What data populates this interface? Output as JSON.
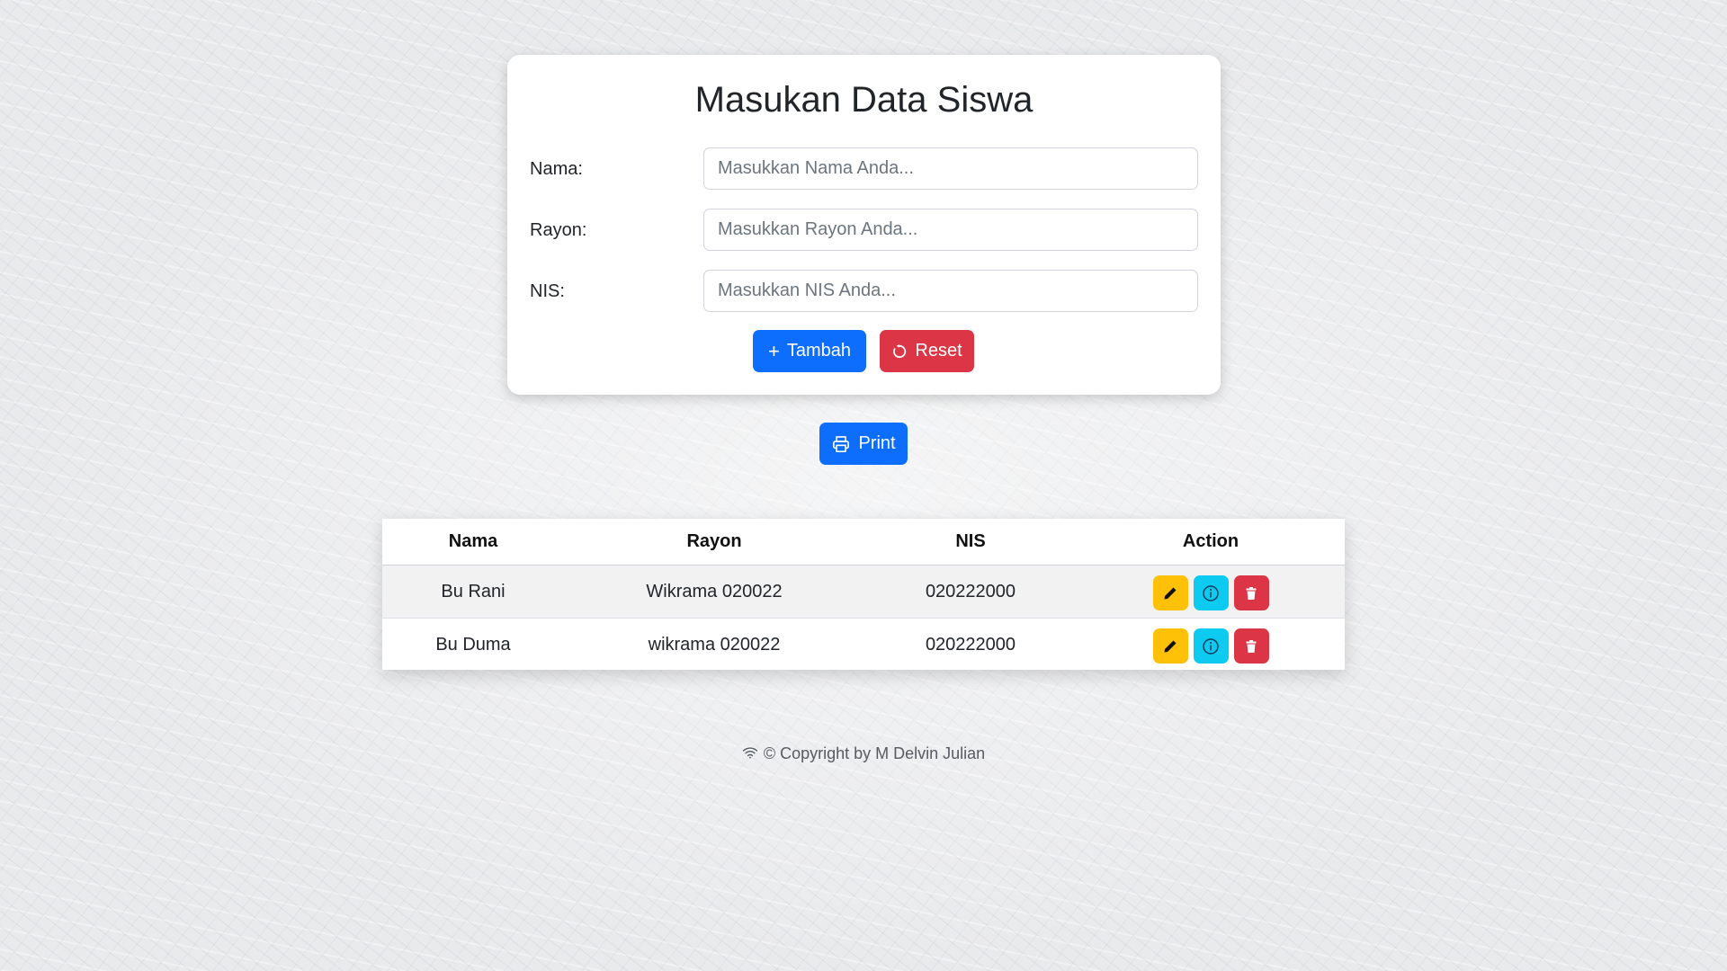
{
  "form": {
    "title": "Masukan Data Siswa",
    "fields": [
      {
        "label": "Nama:",
        "placeholder": "Masukkan Nama Anda...",
        "value": ""
      },
      {
        "label": "Rayon:",
        "placeholder": "Masukkan Rayon Anda...",
        "value": ""
      },
      {
        "label": "NIS:",
        "placeholder": "Masukkan NIS Anda...",
        "value": ""
      }
    ],
    "add_label": "Tambah",
    "reset_label": "Reset"
  },
  "print_label": "Print",
  "table": {
    "headers": [
      "Nama",
      "Rayon",
      "NIS",
      "Action"
    ],
    "rows": [
      {
        "nama": "Bu Rani",
        "rayon": "Wikrama 020022",
        "nis": "020222000"
      },
      {
        "nama": "Bu Duma",
        "rayon": "wikrama 020022",
        "nis": "020222000"
      }
    ],
    "action_icons": [
      "pencil-icon",
      "info-icon",
      "trash-icon"
    ]
  },
  "footer": {
    "text": "© Copyright by M Delvin Julian",
    "icon": "wifi-icon"
  },
  "colors": {
    "primary": "#0d6efd",
    "danger": "#dc3545",
    "warning": "#ffc107",
    "info": "#0dcaf0"
  }
}
